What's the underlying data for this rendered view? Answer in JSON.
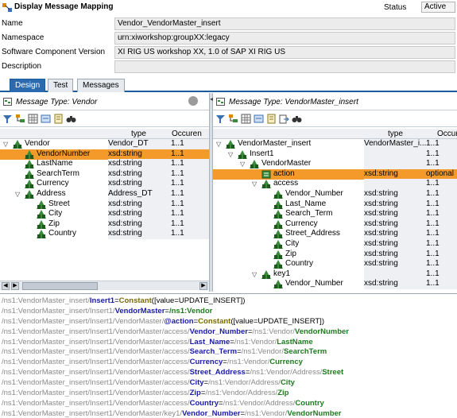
{
  "window": {
    "title": "Display Message Mapping"
  },
  "status": {
    "label": "Status",
    "value": "Active"
  },
  "header_fields": [
    {
      "label": "Name",
      "value": "Vendor_VendorMaster_insert"
    },
    {
      "label": "Namespace",
      "value": "urn:xiworkshop:groupXX:legacy"
    },
    {
      "label": "Software Component Version",
      "value": "XI RIG US workshop XX, 1.0 of SAP XI RIG US"
    },
    {
      "label": "Description",
      "value": ""
    }
  ],
  "tabs": [
    {
      "label": "Design",
      "active": true
    },
    {
      "label": "Test",
      "active": false
    },
    {
      "label": "Messages",
      "active": false
    }
  ],
  "left": {
    "title": "Message Type: Vendor",
    "columns": {
      "name": "",
      "type": "type",
      "occ": "Occuren"
    },
    "rows": [
      {
        "name": "Vendor",
        "type": "Vendor_DT",
        "occ": "1..1",
        "level": 0,
        "expanded": true
      },
      {
        "name": "VendorNumber",
        "type": "xsd:string",
        "occ": "1..1",
        "level": 1,
        "highlight": true
      },
      {
        "name": "LastName",
        "type": "xsd:string",
        "occ": "1..1",
        "level": 1
      },
      {
        "name": "SearchTerm",
        "type": "xsd:string",
        "occ": "1..1",
        "level": 1
      },
      {
        "name": "Currency",
        "type": "xsd:string",
        "occ": "1..1",
        "level": 1
      },
      {
        "name": "Address",
        "type": "Address_DT",
        "occ": "1..1",
        "level": 1,
        "expanded": true
      },
      {
        "name": "Street",
        "type": "xsd:string",
        "occ": "1..1",
        "level": 2
      },
      {
        "name": "City",
        "type": "xsd:string",
        "occ": "1..1",
        "level": 2
      },
      {
        "name": "Zip",
        "type": "xsd:string",
        "occ": "1..1",
        "level": 2
      },
      {
        "name": "Country",
        "type": "xsd:string",
        "occ": "1..1",
        "level": 2
      }
    ]
  },
  "right": {
    "title": "Message Type: VendorMaster_insert",
    "columns": {
      "name": "",
      "type": "type",
      "occ": "Occurren"
    },
    "rows": [
      {
        "name": "VendorMaster_insert",
        "type": "VendorMaster_i...",
        "occ": "1..1",
        "level": 0,
        "expanded": true
      },
      {
        "name": "Insert1",
        "type": "",
        "occ": "1..1",
        "level": 1,
        "expanded": true
      },
      {
        "name": "VendorMaster",
        "type": "",
        "occ": "1..1",
        "level": 2,
        "expanded": true
      },
      {
        "name": "action",
        "type": "xsd:string",
        "occ": "optional",
        "level": 3,
        "highlight": true,
        "attr": true
      },
      {
        "name": "access",
        "type": "",
        "occ": "1..1",
        "level": 3,
        "expanded": true
      },
      {
        "name": "Vendor_Number",
        "type": "xsd:string",
        "occ": "1..1",
        "level": 4
      },
      {
        "name": "Last_Name",
        "type": "xsd:string",
        "occ": "1..1",
        "level": 4
      },
      {
        "name": "Search_Term",
        "type": "xsd:string",
        "occ": "1..1",
        "level": 4
      },
      {
        "name": "Currency",
        "type": "xsd:string",
        "occ": "1..1",
        "level": 4
      },
      {
        "name": "Street_Address",
        "type": "xsd:string",
        "occ": "1..1",
        "level": 4
      },
      {
        "name": "City",
        "type": "xsd:string",
        "occ": "1..1",
        "level": 4
      },
      {
        "name": "Zip",
        "type": "xsd:string",
        "occ": "1..1",
        "level": 4
      },
      {
        "name": "Country",
        "type": "xsd:string",
        "occ": "1..1",
        "level": 4
      },
      {
        "name": "key1",
        "type": "",
        "occ": "1..1",
        "level": 3,
        "expanded": true
      },
      {
        "name": "Vendor_Number",
        "type": "xsd:string",
        "occ": "1..1",
        "level": 4
      }
    ]
  },
  "mappings": [
    [
      [
        "path",
        "/ns1:VendorMaster_insert/"
      ],
      [
        "tgt",
        "Insert1"
      ],
      [
        "op",
        "="
      ],
      [
        "fn",
        "Constant"
      ],
      [
        "op",
        "([value=UPDATE_INSERT])"
      ]
    ],
    [
      [
        "path",
        "/ns1:VendorMaster_insert/Insert1/"
      ],
      [
        "tgt",
        "VendorMaster"
      ],
      [
        "op",
        "="
      ],
      [
        "src",
        "/ns1:Vendor"
      ]
    ],
    [
      [
        "path",
        "/ns1:VendorMaster_insert/Insert1/VendorMaster/"
      ],
      [
        "tgt",
        "@action"
      ],
      [
        "op",
        "="
      ],
      [
        "fn",
        "Constant"
      ],
      [
        "op",
        "([value=UPDATE_INSERT])"
      ]
    ],
    [
      [
        "path",
        "/ns1:VendorMaster_insert/Insert1/VendorMaster/access/"
      ],
      [
        "tgt",
        "Vendor_Number"
      ],
      [
        "op",
        "="
      ],
      [
        "path",
        "/ns1:Vendor/"
      ],
      [
        "src",
        "VendorNumber"
      ]
    ],
    [
      [
        "path",
        "/ns1:VendorMaster_insert/Insert1/VendorMaster/access/"
      ],
      [
        "tgt",
        "Last_Name"
      ],
      [
        "op",
        "="
      ],
      [
        "path",
        "/ns1:Vendor/"
      ],
      [
        "src",
        "LastName"
      ]
    ],
    [
      [
        "path",
        "/ns1:VendorMaster_insert/Insert1/VendorMaster/access/"
      ],
      [
        "tgt",
        "Search_Term"
      ],
      [
        "op",
        "="
      ],
      [
        "path",
        "/ns1:Vendor/"
      ],
      [
        "src",
        "SearchTerm"
      ]
    ],
    [
      [
        "path",
        "/ns1:VendorMaster_insert/Insert1/VendorMaster/access/"
      ],
      [
        "tgt",
        "Currency"
      ],
      [
        "op",
        "="
      ],
      [
        "path",
        "/ns1:Vendor/"
      ],
      [
        "src",
        "Currency"
      ]
    ],
    [
      [
        "path",
        "/ns1:VendorMaster_insert/Insert1/VendorMaster/access/"
      ],
      [
        "tgt",
        "Street_Address"
      ],
      [
        "op",
        "="
      ],
      [
        "path",
        "/ns1:Vendor/Address/"
      ],
      [
        "src",
        "Street"
      ]
    ],
    [
      [
        "path",
        "/ns1:VendorMaster_insert/Insert1/VendorMaster/access/"
      ],
      [
        "tgt",
        "City"
      ],
      [
        "op",
        "="
      ],
      [
        "path",
        "/ns1:Vendor/Address/"
      ],
      [
        "src",
        "City"
      ]
    ],
    [
      [
        "path",
        "/ns1:VendorMaster_insert/Insert1/VendorMaster/access/"
      ],
      [
        "tgt",
        "Zip"
      ],
      [
        "op",
        "="
      ],
      [
        "path",
        "/ns1:Vendor/Address/"
      ],
      [
        "src",
        "Zip"
      ]
    ],
    [
      [
        "path",
        "/ns1:VendorMaster_insert/Insert1/VendorMaster/access/"
      ],
      [
        "tgt",
        "Country"
      ],
      [
        "op",
        "="
      ],
      [
        "path",
        "/ns1:Vendor/Address/"
      ],
      [
        "src",
        "Country"
      ]
    ],
    [
      [
        "path",
        "/ns1:VendorMaster_insert/Insert1/VendorMaster/key1/"
      ],
      [
        "tgt",
        "Vendor_Number"
      ],
      [
        "op",
        "="
      ],
      [
        "path",
        "/ns1:Vendor/"
      ],
      [
        "src",
        "VendorNumber"
      ]
    ]
  ],
  "colors": {
    "tab_active": "#2c6ab0",
    "highlight": "#f39a2b",
    "node_icon": "#3a8a3a"
  }
}
